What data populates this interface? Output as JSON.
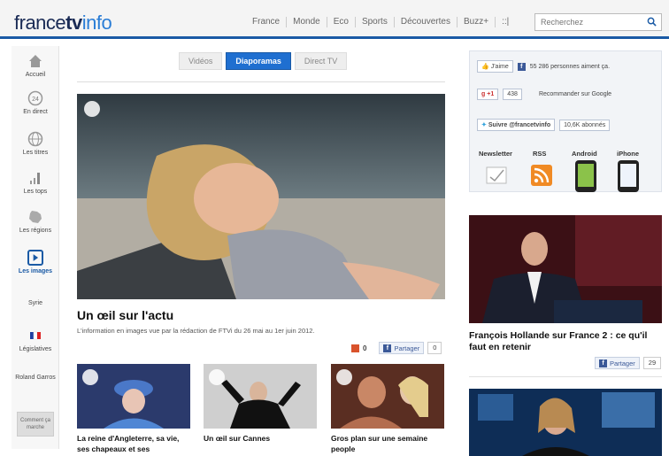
{
  "header": {
    "logo_main": "france",
    "logo_tv": "tv",
    "logo_info": "info",
    "nav": [
      "France",
      "Monde",
      "Eco",
      "Sports",
      "Découvertes",
      "Buzz+",
      "::|"
    ],
    "search_placeholder": "Recherchez",
    "accent": "#1a5aa5"
  },
  "sidebar": {
    "items": [
      {
        "label": "Accueil",
        "icon": "home-icon"
      },
      {
        "label": "En direct",
        "icon": "live-24-icon"
      },
      {
        "label": "Les titres",
        "icon": "globe-icon"
      },
      {
        "label": "Les tops",
        "icon": "bar-chart-icon"
      },
      {
        "label": "Les régions",
        "icon": "map-icon"
      },
      {
        "label": "Les images",
        "icon": "play-icon"
      },
      {
        "label": "Syrie",
        "icon": ""
      },
      {
        "label": "Législatives",
        "icon": "flag-icon"
      },
      {
        "label": "Roland Garros",
        "icon": ""
      }
    ],
    "button_label": "Comment ça marche"
  },
  "tabs": [
    {
      "label": "Vidéos",
      "active": false
    },
    {
      "label": "Diaporamas",
      "active": true
    },
    {
      "label": "Direct TV",
      "active": false
    }
  ],
  "hero": {
    "title": "Un œil sur l'actu",
    "description": "L'information en images vue par la rédaction de FTVi du 26 mai au 1er juin 2012.",
    "comment_count": "0",
    "share_label": "Partager",
    "share_count": "0"
  },
  "thumbs": [
    {
      "caption": "La reine d'Angleterre, sa vie, ses chapeaux et ses"
    },
    {
      "caption": "Un œil sur Cannes"
    },
    {
      "caption": "Gros plan sur une semaine people"
    }
  ],
  "social": {
    "like_label": "J'aime",
    "fb_text": "55 286 personnes aiment ça.",
    "gplus_label": "+1",
    "gplus_count": "438",
    "gplus_text": "Recommander sur Google",
    "twitter_label": "Suivre @francetvinfo",
    "twitter_count": "10,6K abonnés",
    "links": [
      "Newsletter",
      "RSS",
      "Android",
      "iPhone"
    ]
  },
  "right": {
    "card_title": "François Hollande sur France 2 : ce qu'il faut en retenir",
    "share_label": "Partager",
    "share_count": "29"
  }
}
